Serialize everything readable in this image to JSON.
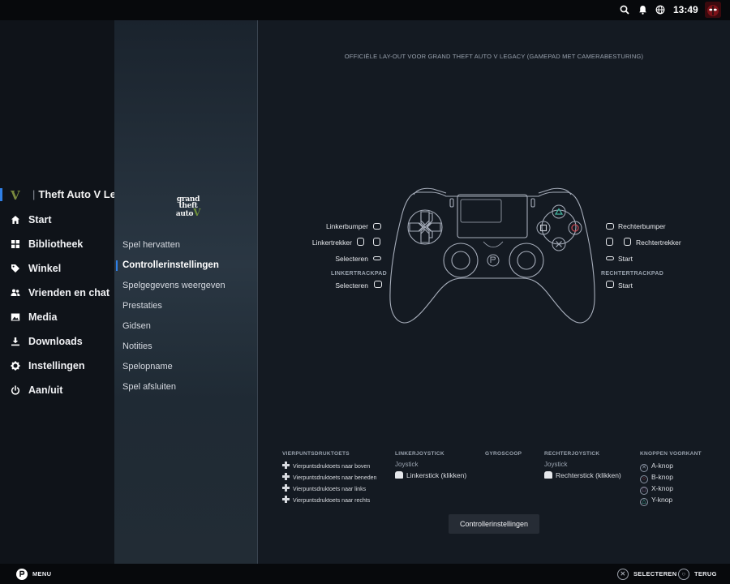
{
  "topbar": {
    "clock": "13:49",
    "icons": [
      "search-icon",
      "bell-icon",
      "globe-icon"
    ]
  },
  "sidebar": {
    "game_logo": "V",
    "game_title": "Theft Auto V Legacy",
    "items": [
      {
        "label": "Start",
        "icon": "home-icon"
      },
      {
        "label": "Bibliotheek",
        "icon": "grid-icon"
      },
      {
        "label": "Winkel",
        "icon": "tag-icon"
      },
      {
        "label": "Vrienden en chat",
        "icon": "people-icon"
      },
      {
        "label": "Media",
        "icon": "image-icon"
      },
      {
        "label": "Downloads",
        "icon": "download-icon"
      },
      {
        "label": "Instellingen",
        "icon": "gear-icon"
      },
      {
        "label": "Aan/uit",
        "icon": "power-icon"
      }
    ]
  },
  "game_menu": {
    "logo_lines": [
      "grand",
      "theft",
      "auto"
    ],
    "items": [
      {
        "label": "Spel hervatten",
        "active": false
      },
      {
        "label": "Controllerinstellingen",
        "active": true
      },
      {
        "label": "Spelgegevens weergeven",
        "active": false
      },
      {
        "label": "Prestaties",
        "active": false
      },
      {
        "label": "Gidsen",
        "active": false
      },
      {
        "label": "Notities",
        "active": false
      },
      {
        "label": "Spelopname",
        "active": false
      },
      {
        "label": "Spel afsluiten",
        "active": false
      }
    ]
  },
  "main": {
    "layout_title": "OFFICIËLE LAY-OUT VOOR GRAND THEFT AUTO V LEGACY (GAMEPAD MET CAMERABESTURING)",
    "left_labels": {
      "linkerbumper": "Linkerbumper",
      "linkertrekker": "Linkertrekker",
      "selecteren": "Selecteren",
      "trackpad_head": "LINKERTRACKPAD",
      "trackpad_action": "Selecteren"
    },
    "right_labels": {
      "rechterbumper": "Rechterbumper",
      "rechtertrekker": "Rechtertrekker",
      "start": "Start",
      "trackpad_head": "RECHTERTRACKPAD",
      "trackpad_action": "Start"
    },
    "legend": {
      "dpad": {
        "head": "VIERPUNTSDRUKTOETS",
        "items": [
          "Vierpuntsdruktoets naar boven",
          "Vierpuntsdruktoets naar beneden",
          "Vierpuntsdruktoets naar links",
          "Vierpuntsdruktoets naar rechts"
        ]
      },
      "left_stick": {
        "head": "LINKERJOYSTICK",
        "sub": "Joystick",
        "item": "Linkerstick (klikken)"
      },
      "gyro": {
        "head": "GYROSCOOP"
      },
      "right_stick": {
        "head": "RECHTERJOYSTICK",
        "sub": "Joystick",
        "item": "Rechterstick (klikken)"
      },
      "face": {
        "head": "KNOPPEN VOORKANT",
        "items": [
          {
            "label": "A-knop",
            "symbol": "✕",
            "color": "#8a93a3"
          },
          {
            "label": "B-knop",
            "symbol": "○",
            "color": "#c0454f"
          },
          {
            "label": "X-knop",
            "symbol": "□",
            "color": "#b77ab1"
          },
          {
            "label": "Y-knop",
            "symbol": "△",
            "color": "#45b5a1"
          }
        ]
      }
    },
    "button": "Controllerinstellingen"
  },
  "bottombar": {
    "menu": "MENU",
    "select": "SELECTEREN",
    "back": "TERUG"
  },
  "colors": {
    "accent": "#2f7fe6",
    "background": "#141a22"
  }
}
